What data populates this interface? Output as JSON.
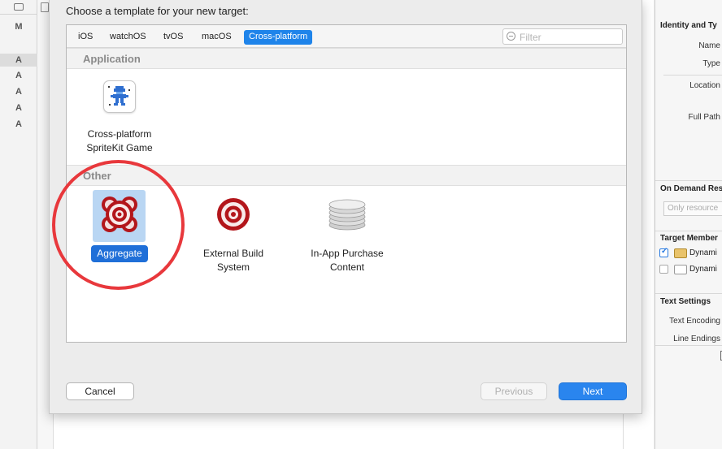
{
  "left_rail": {
    "letters": [
      "M",
      "A",
      "A",
      "A",
      "A",
      "A"
    ]
  },
  "inspector": {
    "identity_title": "Identity and Ty",
    "name_label": "Name",
    "type_label": "Type",
    "location_label": "Location",
    "full_path_label": "Full Path",
    "on_demand_title": "On Demand Res",
    "only_resources_placeholder": "Only resource",
    "target_membership_title": "Target Member",
    "members": [
      {
        "label": "Dynami",
        "checked": true
      },
      {
        "label": "Dynami",
        "checked": false
      }
    ],
    "text_settings_title": "Text Settings",
    "text_encoding_label": "Text Encoding",
    "line_endings_label": "Line Endings"
  },
  "dialog": {
    "title": "Choose a template for your new target:",
    "tabs": [
      "iOS",
      "watchOS",
      "tvOS",
      "macOS",
      "Cross-platform"
    ],
    "active_tab": "Cross-platform",
    "filter_placeholder": "Filter",
    "sections": {
      "application": {
        "heading": "Application",
        "templates": [
          {
            "line1": "Cross-platform",
            "line2": "SpriteKit Game",
            "icon": "spritekit-game-icon"
          }
        ]
      },
      "other": {
        "heading": "Other",
        "templates": [
          {
            "line1": "Aggregate",
            "line2": "",
            "icon": "aggregate-target-icon",
            "selected": true
          },
          {
            "line1": "External Build",
            "line2": "System",
            "icon": "external-build-target-icon"
          },
          {
            "line1": "In-App Purchase",
            "line2": "Content",
            "icon": "coin-stack-icon"
          }
        ]
      }
    },
    "buttons": {
      "cancel": "Cancel",
      "previous": "Previous",
      "next": "Next"
    }
  },
  "colors": {
    "accent": "#1f84ea",
    "selection_label": "#1f6fd8",
    "annotation_circle": "#e8383c",
    "target_red": "#b3161b"
  }
}
